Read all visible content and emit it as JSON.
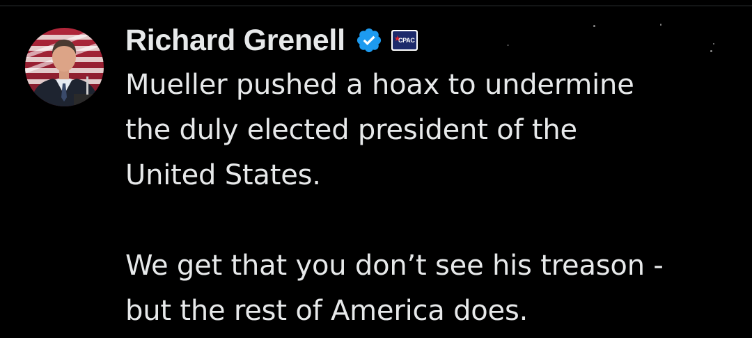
{
  "author": {
    "display_name": "Richard Grenell",
    "verified_icon": "verified-badge-icon",
    "affiliate_badge": {
      "text": "CPAC",
      "icon": "cpac-affiliate-icon"
    }
  },
  "tweet": {
    "text": "Mueller pushed a hoax to undermine\nthe duly elected president of the\nUnited States.\n\nWe get that you don’t see his treason -\nbut the rest of America does."
  },
  "colors": {
    "background": "#000000",
    "text": "#e7e9ea",
    "verified": "#1d9bf0"
  }
}
